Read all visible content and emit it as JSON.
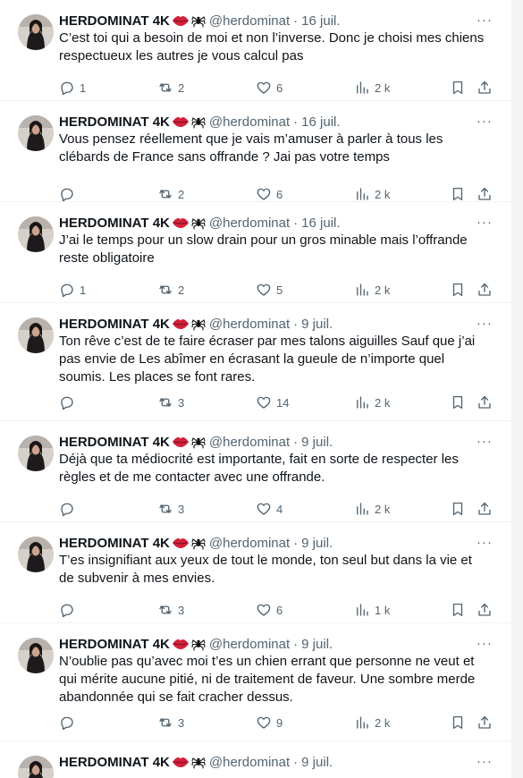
{
  "tweets": [
    {
      "name": "HERDOMINAT 4K",
      "handle": "@herdominat",
      "time": "16 juil.",
      "text": "C’est toi qui a besoin de moi et non l’inverse. Donc je choisi mes chiens respectueux les autres je vous calcul pas",
      "replies": "1",
      "retweets": "2",
      "likes": "6",
      "views": "2 k"
    },
    {
      "name": "HERDOMINAT 4K",
      "handle": "@herdominat",
      "time": "16 juil.",
      "text": "Vous pensez réellement que je vais m’amuser à parler  à tous les clébards de France sans offrande ?  Jai pas votre temps",
      "replies": "",
      "retweets": "2",
      "likes": "6",
      "views": "2 k"
    },
    {
      "name": "HERDOMINAT 4K",
      "handle": "@herdominat",
      "time": "16 juil.",
      "text": "J’ai le temps pour un slow drain pour un gros minable mais l’offrande reste obligatoire",
      "replies": "1",
      "retweets": "2",
      "likes": "5",
      "views": "2 k"
    },
    {
      "name": "HERDOMINAT 4K",
      "handle": "@herdominat",
      "time": "9 juil.",
      "text": "Ton rêve c’est de te faire écraser par mes  talons aiguilles Sauf que j’ai pas envie de Les abîmer en écrasant la gueule de n’importe quel soumis. Les places se font rares.",
      "replies": "",
      "retweets": "3",
      "likes": "14",
      "views": "2 k"
    },
    {
      "name": "HERDOMINAT 4K",
      "handle": "@herdominat",
      "time": "9 juil.",
      "text": "Déjà que ta médiocrité est importante, fait en sorte de respecter les règles et de me contacter avec une offrande.",
      "replies": "",
      "retweets": "3",
      "likes": "4",
      "views": "2 k"
    },
    {
      "name": "HERDOMINAT 4K",
      "handle": "@herdominat",
      "time": "9 juil.",
      "text": "T’es insignifiant aux yeux de tout le monde, ton seul but dans la vie et de subvenir à mes envies.",
      "replies": "",
      "retweets": "3",
      "likes": "6",
      "views": "1 k"
    },
    {
      "name": "HERDOMINAT 4K",
      "handle": "@herdominat",
      "time": "9 juil.",
      "text": "N’oublie pas qu’avec moi t’es un chien errant que personne ne veut et qui mérite aucune pitié, ni de traitement de faveur. Une sombre merde abandonnée qui se fait cracher dessus.",
      "replies": "",
      "retweets": "3",
      "likes": "9",
      "views": "2 k"
    },
    {
      "name": "HERDOMINAT 4K",
      "handle": "@herdominat",
      "time": "9 juil.",
      "text": "",
      "replies": "",
      "retweets": "",
      "likes": "",
      "views": ""
    }
  ],
  "separator": "·",
  "more_label": "···",
  "icons": {
    "reply": "reply-icon",
    "retweet": "retweet-icon",
    "like": "heart-icon",
    "views": "views-chart-icon",
    "bookmark": "bookmark-icon",
    "share": "share-icon",
    "lips": "lips-emoji",
    "spider": "spider-emoji"
  },
  "colors": {
    "text": "#0f1419",
    "secondary": "#536471",
    "border": "#eff3f4",
    "lips": "#d3203a"
  }
}
